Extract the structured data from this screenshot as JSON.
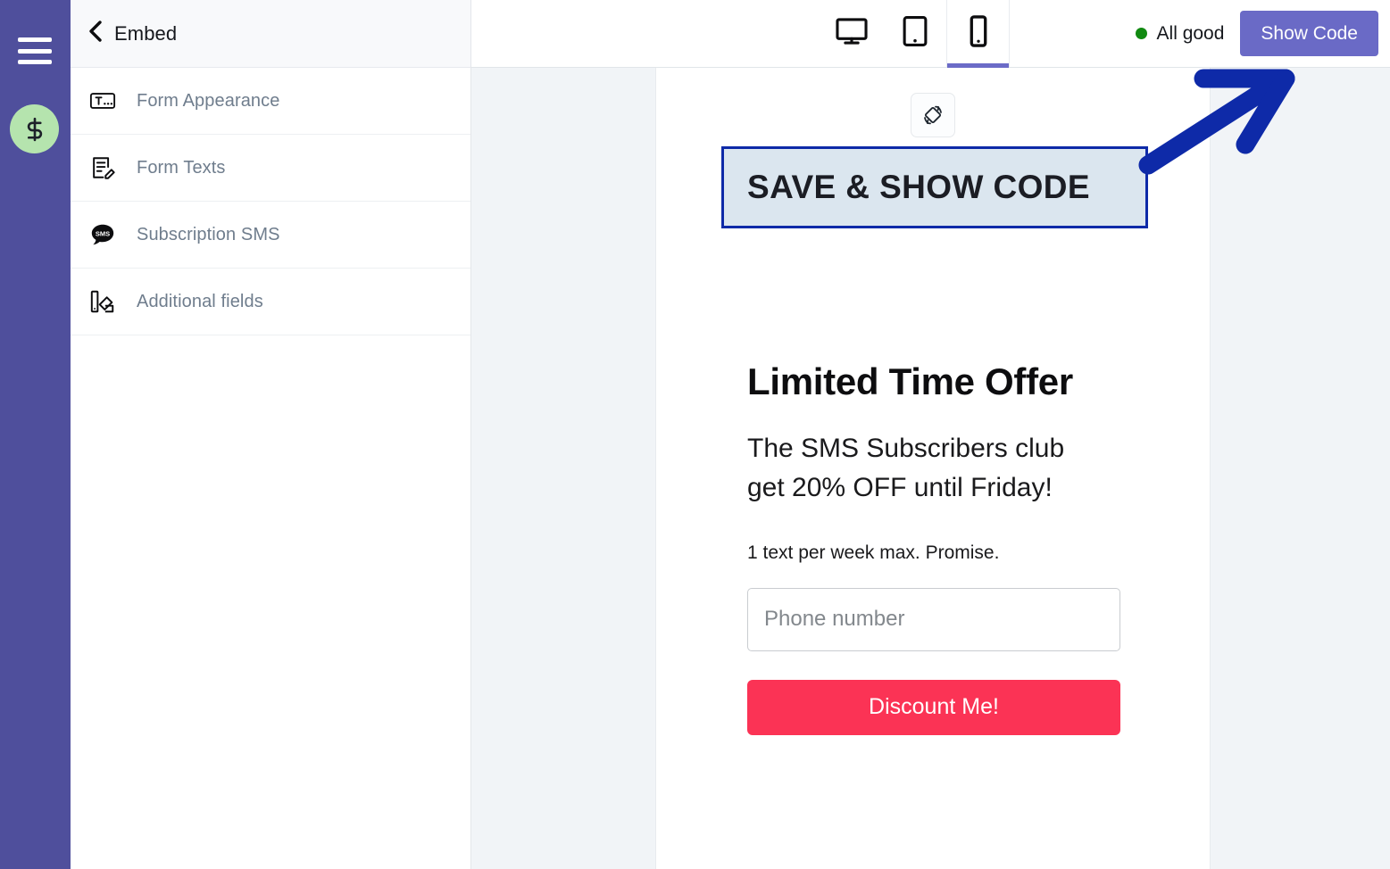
{
  "rail": {
    "menu_icon": "hamburger-menu-icon",
    "money_icon": "dollar-sign-icon"
  },
  "settings": {
    "header": {
      "back_icon": "back-chevron-icon",
      "title": "Embed"
    },
    "items": [
      {
        "label": "Form Appearance",
        "icon": "text-field-icon"
      },
      {
        "label": "Form Texts",
        "icon": "document-edit-icon"
      },
      {
        "label": "Subscription SMS",
        "icon": "sms-bubble-icon"
      },
      {
        "label": "Additional fields",
        "icon": "color-swatch-icon"
      }
    ]
  },
  "topbar": {
    "devices": [
      {
        "name": "desktop",
        "icon": "desktop-monitor-icon",
        "active": false
      },
      {
        "name": "tablet",
        "icon": "tablet-icon",
        "active": false
      },
      {
        "name": "mobile",
        "icon": "mobile-phone-icon",
        "active": true
      }
    ],
    "status_text": "All good",
    "status_color": "#118a11",
    "show_code_label": "Show Code",
    "show_code_color": "#6a6ac6"
  },
  "preview": {
    "rotate_icon": "screen-rotation-icon",
    "highlight": {
      "label": "SAVE & SHOW CODE",
      "fill": "#dbe6ef",
      "border": "#0e2aa8"
    },
    "form": {
      "title": "Limited Time Offer",
      "subtitle": "The SMS Subscribers club get 20% OFF until Friday!",
      "note": "1 text per week max. Promise.",
      "phone_placeholder": "Phone number",
      "phone_value": "",
      "submit_label": "Discount Me!",
      "submit_color": "#fb3355"
    }
  },
  "annotation": {
    "arrow_color": "#0e2aa8",
    "arrow_name": "pointer-arrow-to-show-code"
  }
}
